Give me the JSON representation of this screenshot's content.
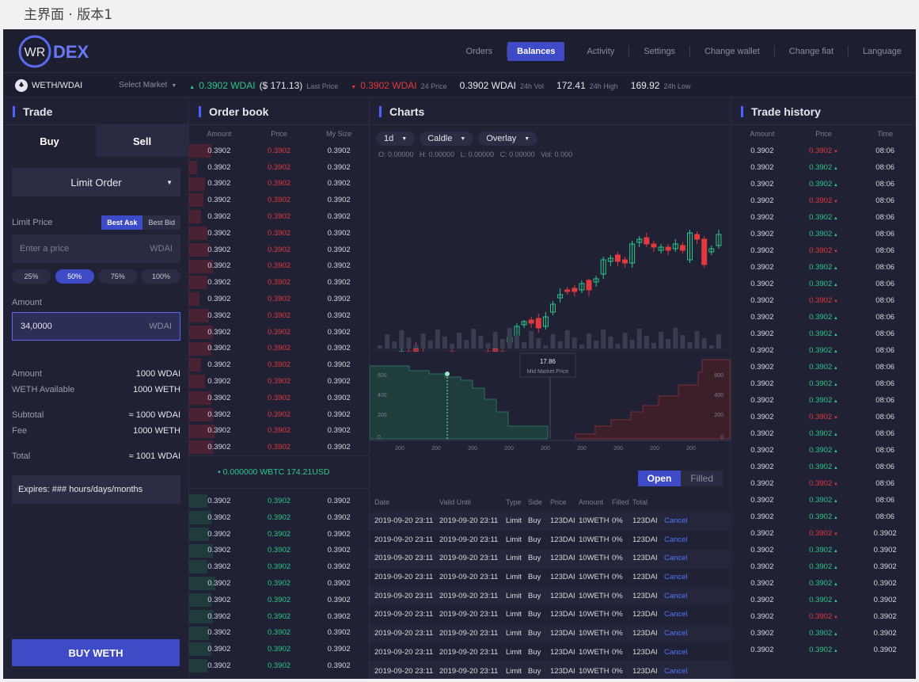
{
  "caption": "主界面 · 版本1",
  "brand": {
    "logo_mark": "WR",
    "logo_text": "DEX"
  },
  "nav": [
    "Orders",
    "Balances",
    "Activity",
    "Settings",
    "Change wallet",
    "Change fiat",
    "Language"
  ],
  "nav_active": "Balances",
  "ticker": {
    "pair": "WETH/WDAI",
    "select_market": "Select Market",
    "last_price": "0.3902 WDAI",
    "last_price_usd": "($ 171.13)",
    "last_price_label": "Last Price",
    "change": "0.3902 WDAI",
    "change_label": "24 Price",
    "vol": "0.3902 WDAI",
    "vol_label": "24h Vol",
    "high": "172.41",
    "high_label": "24h High",
    "low": "169.92",
    "low_label": "24h Low"
  },
  "trade": {
    "title": "Trade",
    "tab_buy": "Buy",
    "tab_sell": "Sell",
    "order_type": "Limit Order",
    "limit_price_label": "Limit Price",
    "best_ask": "Best Ask",
    "best_bid": "Best Bid",
    "price_placeholder": "Enter a price",
    "price_unit": "WDAI",
    "percents": [
      "25%",
      "50%",
      "75%",
      "100%"
    ],
    "percent_active": "50%",
    "amount_label": "Amount",
    "amount_value": "34,0000",
    "amount_unit": "WDAI",
    "summary": [
      {
        "k": "Amount",
        "v": "1000 WDAI"
      },
      {
        "k": "WETH Available",
        "v": "1000 WETH"
      },
      {
        "k": "Subtotal",
        "v": "≈ 1000 WDAI"
      },
      {
        "k": "Fee",
        "v": "1000 WETH"
      },
      {
        "k": "Total",
        "v": "≈ 1001 WDAI"
      }
    ],
    "expires": "Expires: ### hours/days/months",
    "buy_button": "BUY WETH"
  },
  "orderbook": {
    "title": "Order book",
    "headers": [
      "Amount",
      "Price",
      "My Size"
    ],
    "asks": [
      [
        "0.3902",
        "0.3902",
        "0.3902",
        0.55
      ],
      [
        "0.3902",
        "0.3902",
        "0.3902",
        0.2
      ],
      [
        "0.3902",
        "0.3902",
        "0.3902",
        0.4
      ],
      [
        "0.3902",
        "0.3902",
        "0.3902",
        0.35
      ],
      [
        "0.3902",
        "0.3902",
        "0.3902",
        0.3
      ],
      [
        "0.3902",
        "0.3902",
        "0.3902",
        0.45
      ],
      [
        "0.3902",
        "0.3902",
        "0.3902",
        0.5
      ],
      [
        "0.3902",
        "0.3902",
        "0.3902",
        0.6
      ],
      [
        "0.3902",
        "0.3902",
        "0.3902",
        0.45
      ],
      [
        "0.3902",
        "0.3902",
        "0.3902",
        0.25
      ],
      [
        "0.3902",
        "0.3902",
        "0.3902",
        0.5
      ],
      [
        "0.3902",
        "0.3902",
        "0.3902",
        0.6
      ],
      [
        "0.3902",
        "0.3902",
        "0.3902",
        0.55
      ],
      [
        "0.3902",
        "0.3902",
        "0.3902",
        0.3
      ],
      [
        "0.3902",
        "0.3902",
        "0.3902",
        0.4
      ],
      [
        "0.3902",
        "0.3902",
        "0.3902",
        0.55
      ],
      [
        "0.3902",
        "0.3902",
        "0.3902",
        0.6
      ],
      [
        "0.3902",
        "0.3902",
        "0.3902",
        0.65
      ],
      [
        "0.3902",
        "0.3902",
        "0.3902",
        0.6
      ]
    ],
    "mid": "• 0.000000 WBTC 174.21USD",
    "bids": [
      [
        "0.3902",
        "0.3902",
        "0.3902",
        0.45
      ],
      [
        "0.3902",
        "0.3902",
        "0.3902",
        0.55
      ],
      [
        "0.3902",
        "0.3902",
        "0.3902",
        0.5
      ],
      [
        "0.3902",
        "0.3902",
        "0.3902",
        0.6
      ],
      [
        "0.3902",
        "0.3902",
        "0.3902",
        0.45
      ],
      [
        "0.3902",
        "0.3902",
        "0.3902",
        0.65
      ],
      [
        "0.3902",
        "0.3902",
        "0.3902",
        0.55
      ],
      [
        "0.3902",
        "0.3902",
        "0.3902",
        0.6
      ],
      [
        "0.3902",
        "0.3902",
        "0.3902",
        0.5
      ],
      [
        "0.3902",
        "0.3902",
        "0.3902",
        0.55
      ],
      [
        "0.3902",
        "0.3902",
        "0.3902",
        0.45
      ]
    ]
  },
  "charts": {
    "title": "Charts",
    "interval": "1d",
    "style": "Caldle",
    "overlay": "Overlay",
    "ohlc": "O: 0.00000   H: 0.00000   L: 0.00000   C: 0.00000   Vol: 0.000",
    "depth_label_value": "17.86",
    "depth_label": "Mid Market Price",
    "depth_y_left": [
      "600",
      "400",
      "200",
      "0"
    ],
    "depth_y_right": [
      "600",
      "400",
      "200",
      "0"
    ],
    "depth_x": [
      "200",
      "200",
      "200",
      "200",
      "200",
      "200",
      "200",
      "200",
      "200"
    ]
  },
  "orders": {
    "tab_open": "Open",
    "tab_filled": "Filled",
    "headers": [
      "Date",
      "Valid Until",
      "Type",
      "Side",
      "Price",
      "Amount",
      "Filled",
      "Total",
      ""
    ],
    "rows": [
      [
        "2019-09-20 23:11",
        "2019-09-20 23:11",
        "Limit",
        "Buy",
        "123DAI",
        "10WETH",
        "0%",
        "123DAI",
        "Cancel"
      ],
      [
        "2019-09-20 23:11",
        "2019-09-20 23:11",
        "Limit",
        "Buy",
        "123DAI",
        "10WETH",
        "0%",
        "123DAI",
        "Cancel"
      ],
      [
        "2019-09-20 23:11",
        "2019-09-20 23:11",
        "Limit",
        "Buy",
        "123DAI",
        "10WETH",
        "0%",
        "123DAI",
        "Cancel"
      ],
      [
        "2019-09-20 23:11",
        "2019-09-20 23:11",
        "Limit",
        "Buy",
        "123DAI",
        "10WETH",
        "0%",
        "123DAI",
        "Cancel"
      ],
      [
        "2019-09-20 23:11",
        "2019-09-20 23:11",
        "Limit",
        "Buy",
        "123DAI",
        "10WETH",
        "0%",
        "123DAI",
        "Cancel"
      ],
      [
        "2019-09-20 23:11",
        "2019-09-20 23:11",
        "Limit",
        "Buy",
        "123DAI",
        "10WETH",
        "0%",
        "123DAI",
        "Cancel"
      ],
      [
        "2019-09-20 23:11",
        "2019-09-20 23:11",
        "Limit",
        "Buy",
        "123DAI",
        "10WETH",
        "0%",
        "123DAI",
        "Cancel"
      ],
      [
        "2019-09-20 23:11",
        "2019-09-20 23:11",
        "Limit",
        "Buy",
        "123DAI",
        "10WETH",
        "0%",
        "123DAI",
        "Cancel"
      ],
      [
        "2019-09-20 23:11",
        "2019-09-20 23:11",
        "Limit",
        "Buy",
        "123DAI",
        "10WETH",
        "0%",
        "123DAI",
        "Cancel"
      ]
    ]
  },
  "history": {
    "title": "Trade history",
    "headers": [
      "Amount",
      "Price",
      "Time"
    ],
    "rows": [
      [
        "0.3902",
        "0.3902",
        "08:06",
        "down"
      ],
      [
        "0.3902",
        "0.3902",
        "08:06",
        "up"
      ],
      [
        "0.3902",
        "0.3902",
        "08:06",
        "up"
      ],
      [
        "0.3902",
        "0.3902",
        "08:06",
        "down"
      ],
      [
        "0.3902",
        "0.3902",
        "08:06",
        "up"
      ],
      [
        "0.3902",
        "0.3902",
        "08:06",
        "up"
      ],
      [
        "0.3902",
        "0.3902",
        "08:06",
        "down"
      ],
      [
        "0.3902",
        "0.3902",
        "08:06",
        "up"
      ],
      [
        "0.3902",
        "0.3902",
        "08:06",
        "up"
      ],
      [
        "0.3902",
        "0.3902",
        "08:06",
        "down"
      ],
      [
        "0.3902",
        "0.3902",
        "08:06",
        "up"
      ],
      [
        "0.3902",
        "0.3902",
        "08:06",
        "up"
      ],
      [
        "0.3902",
        "0.3902",
        "08:06",
        "up"
      ],
      [
        "0.3902",
        "0.3902",
        "08:06",
        "up"
      ],
      [
        "0.3902",
        "0.3902",
        "08:06",
        "up"
      ],
      [
        "0.3902",
        "0.3902",
        "08:06",
        "up"
      ],
      [
        "0.3902",
        "0.3902",
        "08:06",
        "down"
      ],
      [
        "0.3902",
        "0.3902",
        "08:06",
        "up"
      ],
      [
        "0.3902",
        "0.3902",
        "08:06",
        "up"
      ],
      [
        "0.3902",
        "0.3902",
        "08:06",
        "up"
      ],
      [
        "0.3902",
        "0.3902",
        "08:06",
        "down"
      ],
      [
        "0.3902",
        "0.3902",
        "08:06",
        "up"
      ],
      [
        "0.3902",
        "0.3902",
        "08:06",
        "up"
      ],
      [
        "0.3902",
        "0.3902",
        "0.3902",
        "down"
      ],
      [
        "0.3902",
        "0.3902",
        "0.3902",
        "up"
      ],
      [
        "0.3902",
        "0.3902",
        "0.3902",
        "up"
      ],
      [
        "0.3902",
        "0.3902",
        "0.3902",
        "up"
      ],
      [
        "0.3902",
        "0.3902",
        "0.3902",
        "up"
      ],
      [
        "0.3902",
        "0.3902",
        "0.3902",
        "down"
      ],
      [
        "0.3902",
        "0.3902",
        "0.3902",
        "up"
      ],
      [
        "0.3902",
        "0.3902",
        "0.3902",
        "up"
      ]
    ]
  },
  "colors": {
    "accent": "#3f4ac7",
    "up": "#2bc78a",
    "down": "#e2393f",
    "bg": "#1f2033"
  }
}
